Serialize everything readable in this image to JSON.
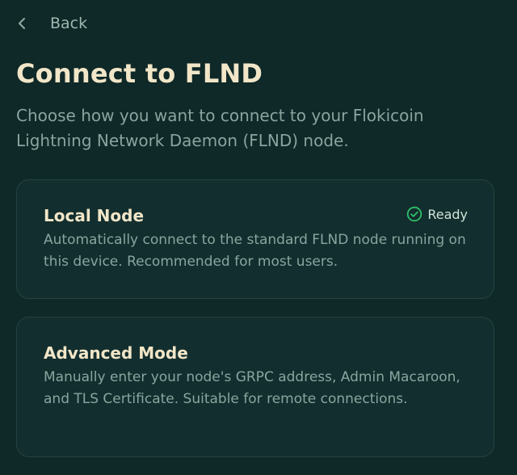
{
  "nav": {
    "back_label": "Back",
    "back_icon": "chevron-left-icon"
  },
  "header": {
    "title": "Connect to FLND",
    "subtitle": "Choose how you want to connect to your Flokicoin Lightning Network Daemon (FLND) node."
  },
  "options": [
    {
      "title": "Local Node",
      "description": "Automatically connect to the standard FLND node running on this device. Recommended for most users.",
      "status": "Ready",
      "status_icon": "check-circle-icon",
      "status_color": "#2fbf6a"
    },
    {
      "title": "Advanced Mode",
      "description": "Manually enter your node's GRPC address, Admin Macaroon, and TLS Certificate. Suitable for remote connections."
    }
  ],
  "colors": {
    "background": "#0f2828",
    "card_background": "#132e2e",
    "card_border": "#26433f",
    "title_text": "#f1e6c8",
    "muted_text": "#89a59f",
    "ready_green": "#2fbf6a"
  }
}
